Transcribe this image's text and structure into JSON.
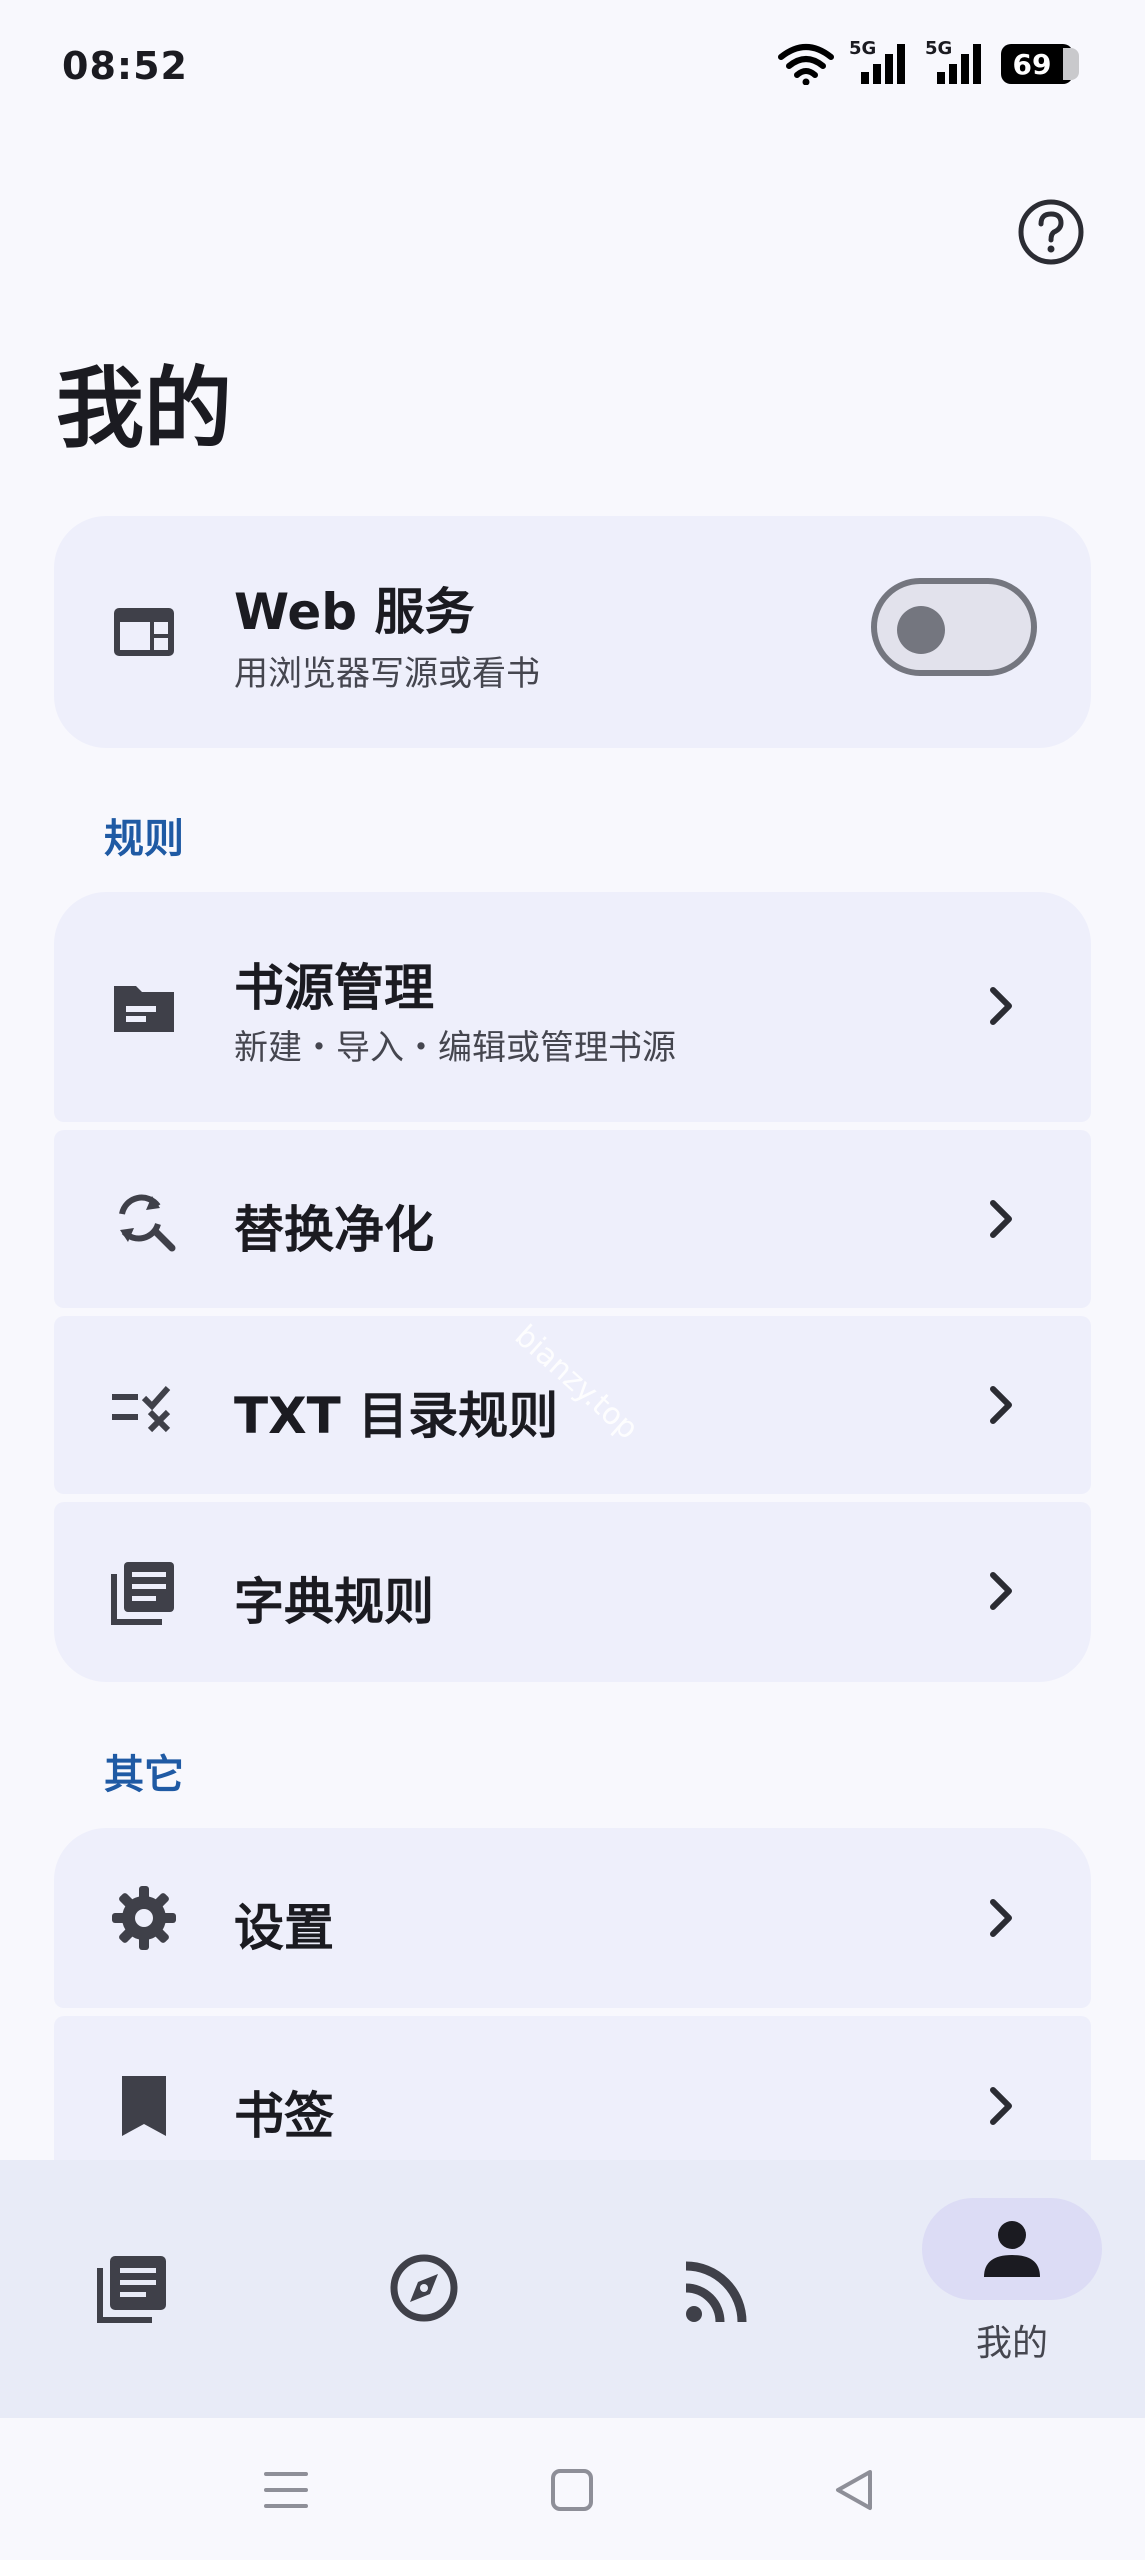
{
  "status_bar": {
    "time": "08:52",
    "battery": "69",
    "signal_1": "5G",
    "signal_2": "5G"
  },
  "page": {
    "title": "我的"
  },
  "web_service": {
    "title": "Web 服务",
    "subtitle": "用浏览器写源或看书",
    "enabled": false
  },
  "sections": {
    "rules": {
      "header": "规则",
      "items": [
        {
          "title": "书源管理",
          "subtitle": "新建・导入・编辑或管理书源"
        },
        {
          "title": "替换净化"
        },
        {
          "title": "TXT 目录规则"
        },
        {
          "title": "字典规则"
        }
      ]
    },
    "other": {
      "header": "其它",
      "items": [
        {
          "title": "设置"
        },
        {
          "title": "书签"
        }
      ]
    }
  },
  "watermark": "bianzy.top",
  "bottom_nav": {
    "active_label": "我的"
  },
  "colors": {
    "accent": "#1f5aa4",
    "card": "#eeeffb",
    "background": "#f8f8fd",
    "nav_background": "#e8ebf7",
    "active_pill": "#dcdcf5"
  }
}
